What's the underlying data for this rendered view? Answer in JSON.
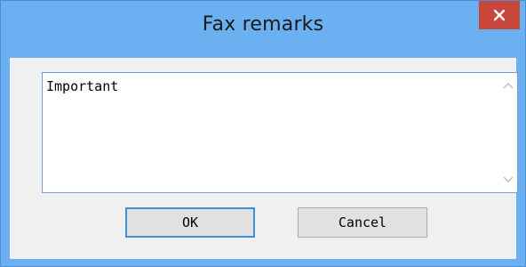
{
  "window": {
    "title": "Fax remarks",
    "close_icon": "close-icon"
  },
  "remarks": {
    "value": "Important"
  },
  "buttons": {
    "ok_label": "OK",
    "cancel_label": "Cancel"
  },
  "colors": {
    "titlebar": "#6bb0f0",
    "close_button": "#c8463a",
    "focus_border": "#3c8fd9"
  }
}
